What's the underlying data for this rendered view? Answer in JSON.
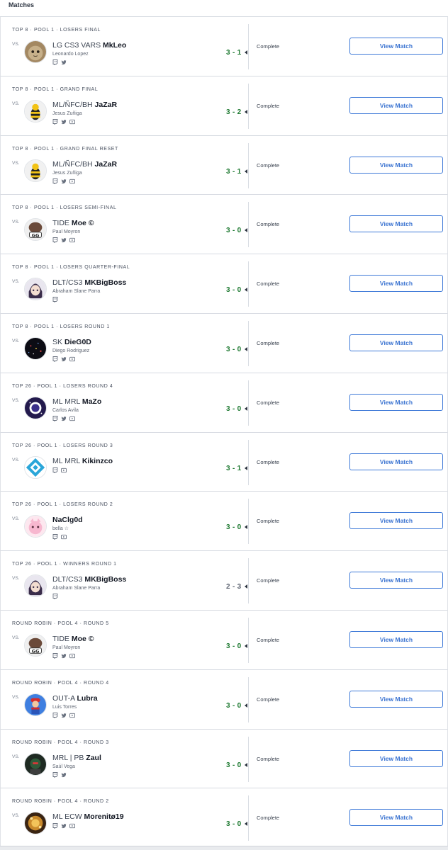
{
  "header": {
    "title": "Matches"
  },
  "colors": {
    "win": "#1f7a32",
    "button": "#3a73d1",
    "divider": "#d6dae1"
  },
  "matches": [
    {
      "round": "TOP 8 · POOL 1 · LOSERS FINAL",
      "vs": "VS.",
      "prefix": "LG CS3 VARS",
      "tag": "MkLeo",
      "name": "Leonardo Lopez",
      "score": "3 - 1",
      "result": "win",
      "status": "Complete",
      "button": "View Match",
      "socials": [
        "twitch-icon",
        "twitter-icon"
      ],
      "avatar": "cat"
    },
    {
      "round": "TOP 8 · POOL 1 · GRAND FINAL",
      "vs": "VS.",
      "prefix": "ML/ÑFC/BH",
      "tag": "JaZaR",
      "name": "Jesus Zuñiga",
      "score": "3 - 2",
      "result": "win",
      "status": "Complete",
      "button": "View Match",
      "socials": [
        "twitch-icon",
        "twitter-icon",
        "youtube-icon"
      ],
      "avatar": "bee"
    },
    {
      "round": "TOP 8 · POOL 1 · GRAND FINAL RESET",
      "vs": "VS.",
      "prefix": "ML/ÑFC/BH",
      "tag": "JaZaR",
      "name": "Jesus Zuñiga",
      "score": "3 - 1",
      "result": "win",
      "status": "Complete",
      "button": "View Match",
      "socials": [
        "twitch-icon",
        "twitter-icon",
        "youtube-icon"
      ],
      "avatar": "bee"
    },
    {
      "round": "TOP 8 · POOL 1 · LOSERS SEMI-FINAL",
      "vs": "VS.",
      "prefix": "TIDE",
      "tag": "Moe ©",
      "name": "Paul Moyron",
      "score": "3 - 0",
      "result": "win",
      "status": "Complete",
      "button": "View Match",
      "socials": [
        "twitch-icon",
        "twitter-icon",
        "youtube-icon"
      ],
      "avatar": "gg"
    },
    {
      "round": "TOP 8 · POOL 1 · LOSERS QUARTER-FINAL",
      "vs": "VS.",
      "prefix": "DLT/CS3",
      "tag": "MKBigBoss",
      "name": "Abraham Slane Parra",
      "score": "3 - 0",
      "result": "win",
      "status": "Complete",
      "button": "View Match",
      "socials": [
        "twitch-icon"
      ],
      "avatar": "anime"
    },
    {
      "round": "TOP 8 · POOL 1 · LOSERS ROUND 1",
      "vs": "VS.",
      "prefix": "SK",
      "tag": "DieG0D",
      "name": "Diego Rodriguez",
      "score": "3 - 0",
      "result": "win",
      "status": "Complete",
      "button": "View Match",
      "socials": [
        "twitch-icon",
        "twitter-icon",
        "youtube-icon"
      ],
      "avatar": "space"
    },
    {
      "round": "TOP 26 · POOL 1 · LOSERS ROUND 4",
      "vs": "VS.",
      "prefix": "ML MRL",
      "tag": "MaZo",
      "name": "Carlos Avila",
      "score": "3 - 0",
      "result": "win",
      "status": "Complete",
      "button": "View Match",
      "socials": [
        "twitch-icon",
        "twitter-icon",
        "youtube-icon"
      ],
      "avatar": "purple"
    },
    {
      "round": "TOP 26 · POOL 1 · LOSERS ROUND 3",
      "vs": "VS.",
      "prefix": "ML MRL",
      "tag": "Kikinzco",
      "name": "",
      "score": "3 - 1",
      "result": "win",
      "status": "Complete",
      "button": "View Match",
      "socials": [
        "twitch-icon",
        "youtube-icon"
      ],
      "avatar": "diamond"
    },
    {
      "round": "TOP 26 · POOL 1 · LOSERS ROUND 2",
      "vs": "VS.",
      "prefix": "",
      "tag": "NaClg0d",
      "name": "bella ☆",
      "score": "3 - 0",
      "result": "win",
      "status": "Complete",
      "button": "View Match",
      "socials": [
        "twitch-icon",
        "youtube-icon"
      ],
      "avatar": "pink"
    },
    {
      "round": "TOP 26 · POOL 1 · WINNERS ROUND 1",
      "vs": "VS.",
      "prefix": "DLT/CS3",
      "tag": "MKBigBoss",
      "name": "Abraham Slane Parra",
      "score": "2 - 3",
      "result": "loss",
      "status": "Complete",
      "button": "View Match",
      "socials": [
        "twitch-icon"
      ],
      "avatar": "anime"
    },
    {
      "round": "ROUND ROBIN · POOL 4 · ROUND 5",
      "vs": "VS.",
      "prefix": "TIDE",
      "tag": "Moe ©",
      "name": "Paul Moyron",
      "score": "3 - 0",
      "result": "win",
      "status": "Complete",
      "button": "View Match",
      "socials": [
        "twitch-icon",
        "twitter-icon",
        "youtube-icon"
      ],
      "avatar": "gg"
    },
    {
      "round": "ROUND ROBIN · POOL 4 · ROUND 4",
      "vs": "VS.",
      "prefix": "OUT-A",
      "tag": "Lubra",
      "name": "Luis Torres",
      "score": "3 - 0",
      "result": "win",
      "status": "Complete",
      "button": "View Match",
      "socials": [
        "twitch-icon",
        "twitter-icon",
        "youtube-icon"
      ],
      "avatar": "mario"
    },
    {
      "round": "ROUND ROBIN · POOL 4 · ROUND 3",
      "vs": "VS.",
      "prefix": "MRL | PB",
      "tag": "Zaul",
      "name": "Saúl Vega",
      "score": "3 - 0",
      "result": "win",
      "status": "Complete",
      "button": "View Match",
      "socials": [
        "twitch-icon",
        "twitter-icon"
      ],
      "avatar": "dark"
    },
    {
      "round": "ROUND ROBIN · POOL 4 · ROUND 2",
      "vs": "VS.",
      "prefix": "ML ECW",
      "tag": "Morenitø19",
      "name": "",
      "score": "3 - 0",
      "result": "win",
      "status": "Complete",
      "button": "View Match",
      "socials": [
        "twitch-icon",
        "twitter-icon",
        "youtube-icon"
      ],
      "avatar": "gold"
    }
  ]
}
